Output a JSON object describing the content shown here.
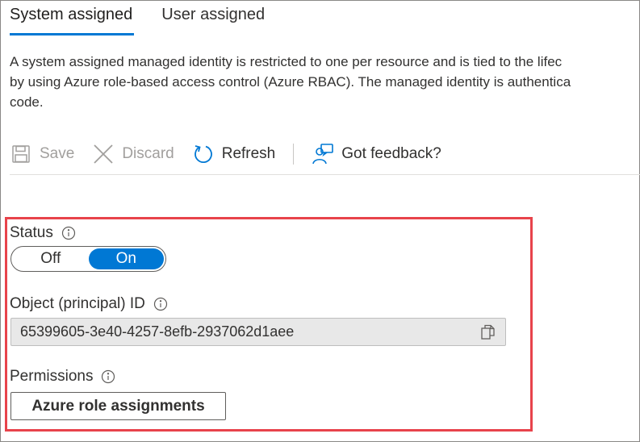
{
  "tabs": [
    {
      "label": "System assigned",
      "active": true
    },
    {
      "label": "User assigned",
      "active": false
    }
  ],
  "description_lines": [
    "A system assigned managed identity is restricted to one per resource and is tied to the lifec",
    "by using Azure role-based access control (Azure RBAC). The managed identity is authentica",
    "code."
  ],
  "toolbar": {
    "save_label": "Save",
    "discard_label": "Discard",
    "refresh_label": "Refresh",
    "feedback_label": "Got feedback?"
  },
  "status": {
    "label": "Status",
    "off_label": "Off",
    "on_label": "On",
    "value": "On"
  },
  "object_id": {
    "label": "Object (principal) ID",
    "value": "65399605-3e40-4257-8efb-2937062d1aee"
  },
  "permissions": {
    "label": "Permissions",
    "button_label": "Azure role assignments"
  },
  "colors": {
    "accent": "#0078d4",
    "highlight_border": "#e8434b"
  }
}
